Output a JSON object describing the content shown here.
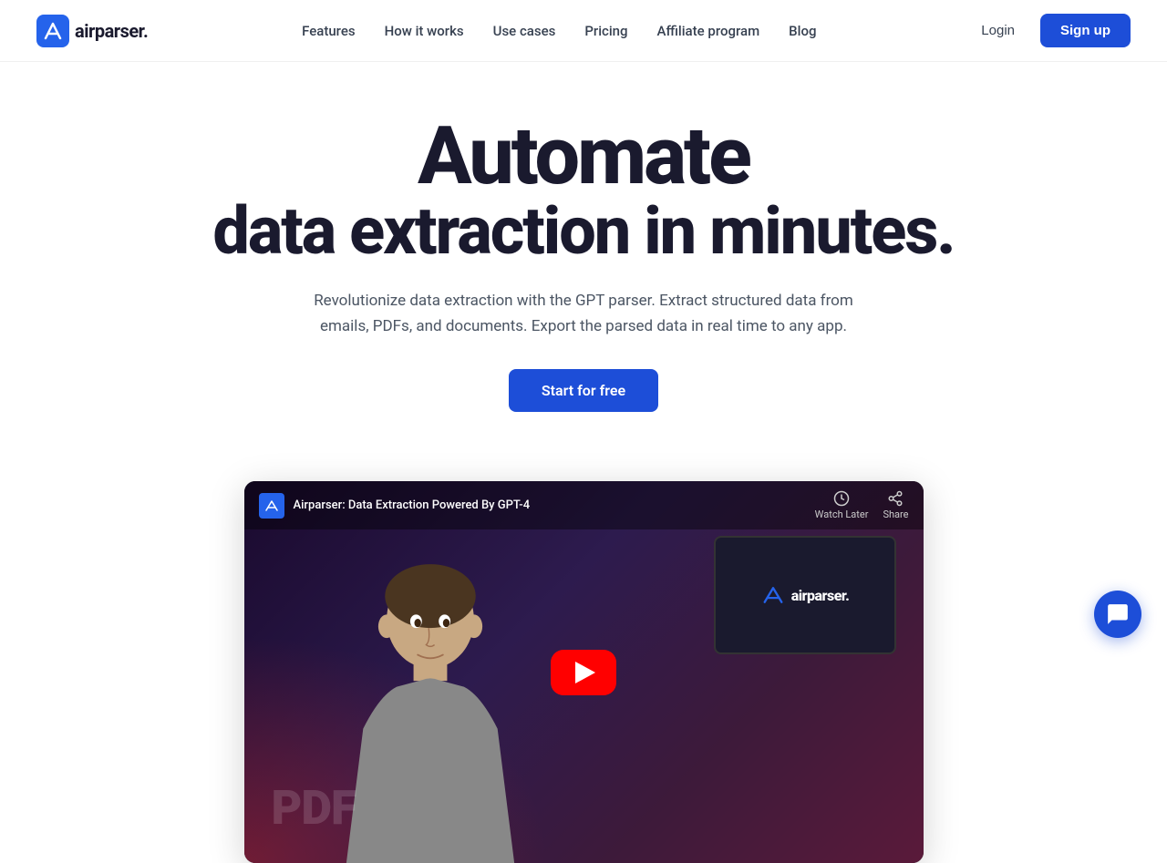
{
  "nav": {
    "logo_text": "airparser.",
    "links": [
      {
        "label": "Features",
        "href": "#"
      },
      {
        "label": "How it works",
        "href": "#"
      },
      {
        "label": "Use cases",
        "href": "#"
      },
      {
        "label": "Pricing",
        "href": "#"
      },
      {
        "label": "Affiliate program",
        "href": "#"
      },
      {
        "label": "Blog",
        "href": "#"
      }
    ],
    "login_label": "Login",
    "signup_label": "Sign up"
  },
  "hero": {
    "title_main": "Automate",
    "title_sub": "data extraction in minutes.",
    "description": "Revolutionize data extraction with the GPT parser. Extract structured data from emails, PDFs, and documents. Export the parsed data in real time to any app.",
    "cta_label": "Start for free"
  },
  "video": {
    "title": "Airparser: Data Extraction Powered By GPT-4",
    "watch_later_label": "Watch Later",
    "share_label": "Share",
    "screen_logo_text": "airparser.",
    "pdf_text": "PDF"
  },
  "chat": {
    "icon": "chat-icon"
  }
}
